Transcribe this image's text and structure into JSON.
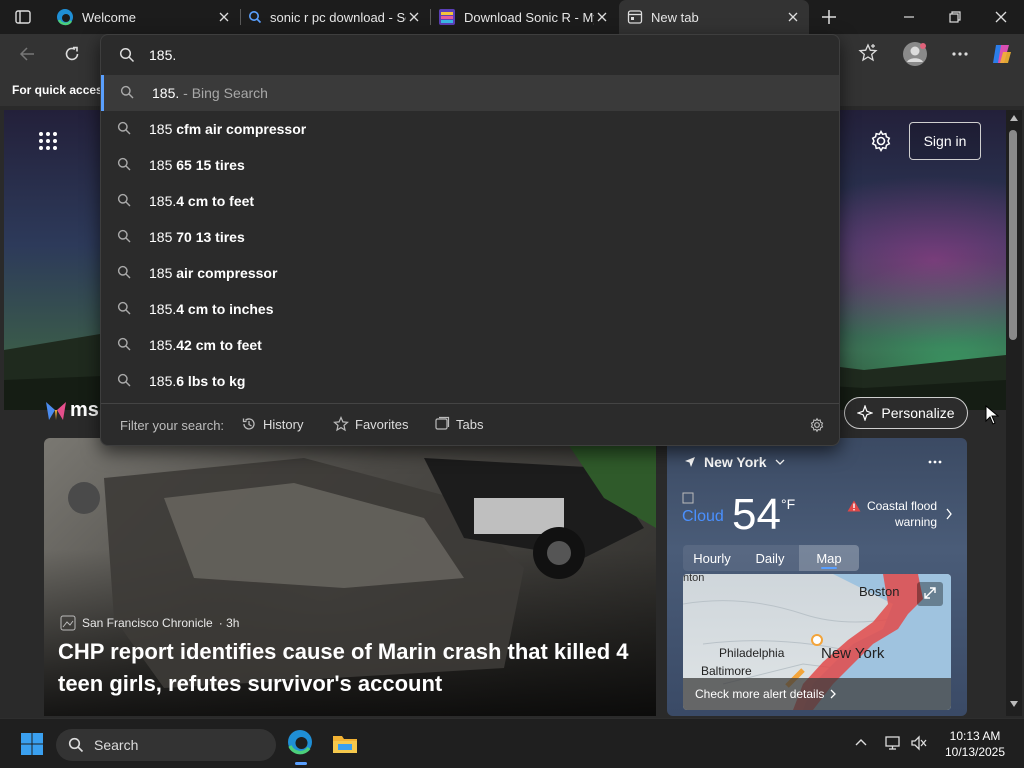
{
  "tabs": [
    {
      "title": "Welcome",
      "icon": "edge-icon"
    },
    {
      "title": "sonic r pc download - Se",
      "icon": "search-icon"
    },
    {
      "title": "Download Sonic R - My",
      "icon": "colorful-app-icon"
    },
    {
      "title": "New tab",
      "icon": "newtab-icon",
      "active": true
    }
  ],
  "favbar": {
    "text": "For quick access"
  },
  "omnibox": {
    "value": "185.",
    "suggestions": [
      {
        "prefix": "185.",
        "suffix": " - Bing Search",
        "kind": "search"
      },
      {
        "prefix": "185 ",
        "suffix": "cfm air compressor"
      },
      {
        "prefix": "185 ",
        "suffix": "65 15 tires"
      },
      {
        "prefix": "185.",
        "suffix": "4 cm to feet"
      },
      {
        "prefix": "185 ",
        "suffix": "70 13 tires"
      },
      {
        "prefix": "185 ",
        "suffix": "air compressor"
      },
      {
        "prefix": "185.",
        "suffix": "4 cm to inches"
      },
      {
        "prefix": "185.",
        "suffix": "42 cm to feet"
      },
      {
        "prefix": "185.",
        "suffix": "6 lbs to kg"
      }
    ],
    "filter_label": "Filter your search:",
    "filters": [
      "History",
      "Favorites",
      "Tabs"
    ]
  },
  "page": {
    "sign_in": "Sign in",
    "msn_text": "msn",
    "personalize": "Personalize"
  },
  "news": {
    "source": "San Francisco Chronicle",
    "age": "· 3h",
    "title": "CHP report identifies cause of Marin crash that killed 4 teen girls, refutes survivor's account"
  },
  "weather": {
    "location": "New York",
    "icon_alt": "Cloud",
    "temp": "54",
    "unit": "°F",
    "alert_line1": "Coastal flood",
    "alert_line2": "warning",
    "tabs": [
      "Hourly",
      "Daily",
      "Map"
    ],
    "active_tab": "Map",
    "map_labels": {
      "city1": "Boston",
      "city2": "Philadelphia",
      "city3": "Baltimore",
      "city4": "New York",
      "city5": "nton"
    },
    "alert_link": "Check more alert details"
  },
  "taskbar": {
    "search": "Search",
    "time": "10:13 AM",
    "date": "10/13/2025"
  },
  "colors": {
    "accent": "#5aa0ff",
    "alert": "#e04848"
  }
}
